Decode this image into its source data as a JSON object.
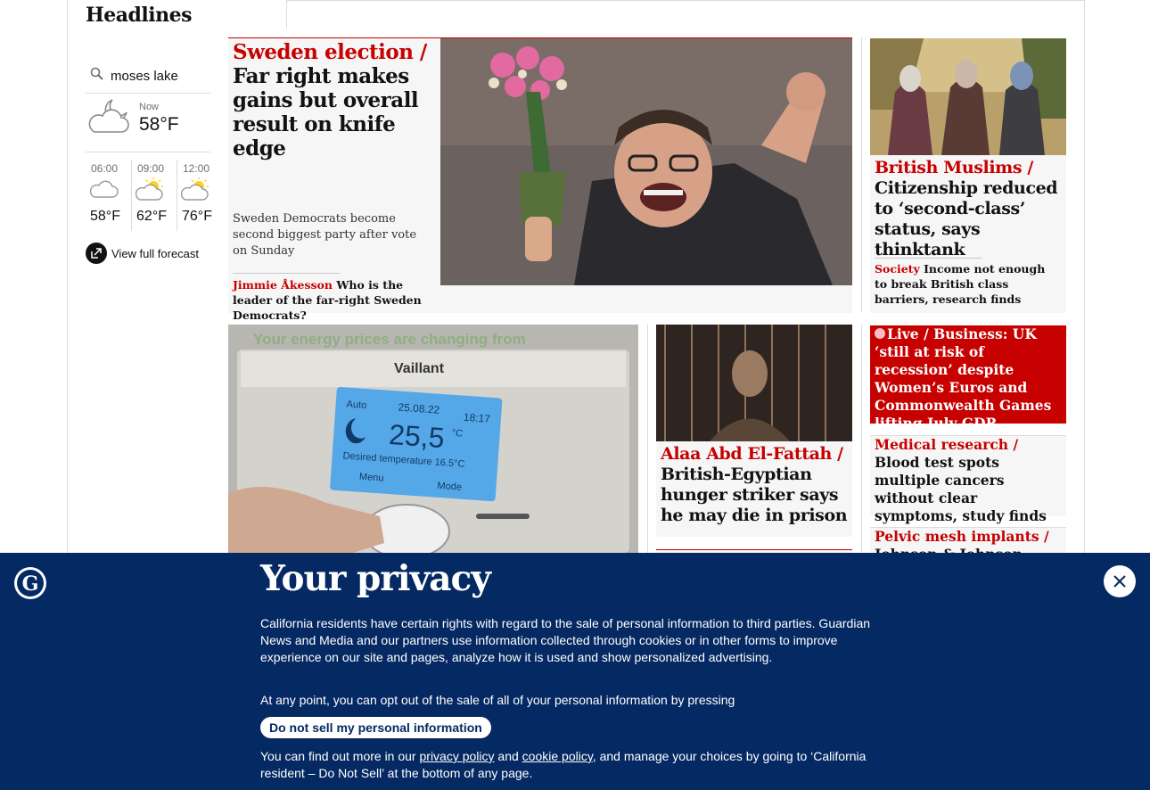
{
  "section": {
    "title": "Headlines"
  },
  "weather": {
    "location": "moses lake",
    "now_label": "Now",
    "now_temp": "58°F",
    "hours": [
      {
        "time": "06:00",
        "temp": "58°F",
        "icon": "cloud-icon"
      },
      {
        "time": "09:00",
        "temp": "62°F",
        "icon": "sun-cloud-icon"
      },
      {
        "time": "12:00",
        "temp": "76°F",
        "icon": "sun-cloud-icon"
      }
    ],
    "forecast_link": "View full forecast"
  },
  "main_story": {
    "kicker": "Sweden election /",
    "headline": "Far right makes gains but overall result on knife edge",
    "standfirst": "Sweden Democrats become second biggest party after vote on Sunday",
    "sublink_kicker": "Jimmie Åkesson",
    "sublink_text": "Who is the leader of the far-right Sweden Democrats?"
  },
  "story_muslims": {
    "kicker": "British Muslims /",
    "headline": "Citizenship reduced to ‘second-class’ status, says thinktank",
    "sublink_kicker": "Society",
    "sublink_text": "Income not enough to break British class barriers, research finds"
  },
  "story_alaa": {
    "kicker": "Alaa Abd El-Fattah /",
    "headline": "British-Egyptian hunger striker says he may die in prison"
  },
  "story_live": {
    "live_label": "Live",
    "headline": "/ Business: UK ‘still at risk of recession’ despite Women’s Euros and Commonwealth Games lifting July GDP"
  },
  "story_medical": {
    "kicker": "Medical research /",
    "headline": "Blood test spots multiple cancers without clear symptoms, study finds"
  },
  "story_mesh": {
    "kicker": "Pelvic mesh implants /",
    "headline": "Johnson & Johnson"
  },
  "energy_image": {
    "banner": "Your energy prices are changing from",
    "brand": "Vaillant",
    "display_date": "25.08.22",
    "display_time": "18:17",
    "display_mode": "Auto",
    "display_temp": "25,5",
    "display_unit": "°C",
    "display_desired": "Desired temperature 16.5°C",
    "btn_menu": "Menu",
    "btn_mode": "Mode"
  },
  "cookie": {
    "title": "Your privacy",
    "p1": "California residents have certain rights with regard to the sale of personal information to third parties. Guardian News and Media and our partners use information collected through cookies or in other forms to improve experience on our site and pages, analyze how it is used and show personalized advertising.",
    "p2": "At any point, you can opt out of the sale of all of your personal information by pressing",
    "button": "Do not sell my personal information",
    "p3_a": "You can find out more in our",
    "privacy_link": "privacy policy",
    "p3_b": "and",
    "cookie_link": "cookie policy",
    "p3_c": ", and manage your choices by going to ‘California resident – Do Not Sell’ at the bottom of any page."
  }
}
